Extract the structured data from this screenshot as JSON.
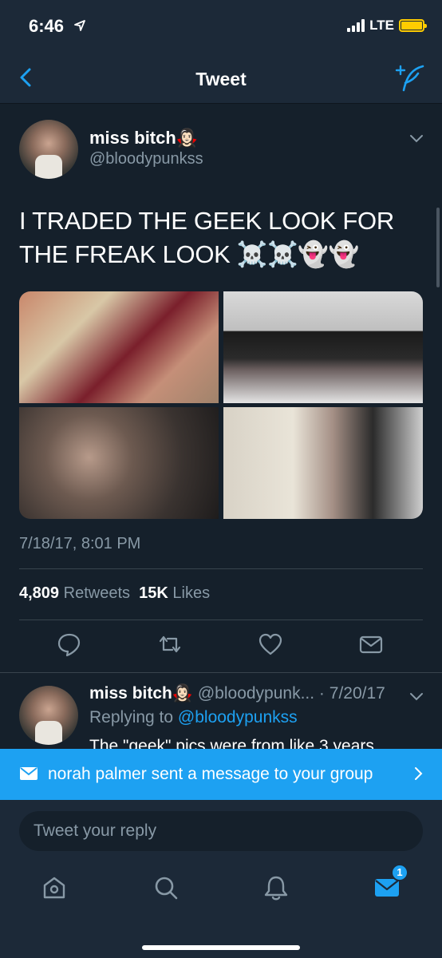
{
  "status_bar": {
    "time": "6:46",
    "network": "LTE",
    "signal_bars": 4,
    "battery_color": "#ffcc00"
  },
  "nav": {
    "title": "Tweet",
    "back_icon": "chevron-left-icon",
    "compose_icon": "compose-tweet-icon"
  },
  "tweet": {
    "display_name": "miss bitch🧛🏻‍♀️",
    "handle": "@bloodypunkss",
    "text": "I TRADED THE GEEK LOOK FOR THE FREAK LOOK ☠️☠️👻👻",
    "date": "7/18/17, 8:01 PM",
    "stats": {
      "retweets_count": "4,809",
      "retweets_label": "Retweets",
      "likes_count": "15K",
      "likes_label": "Likes"
    },
    "actions": [
      "reply-icon",
      "retweet-icon",
      "like-icon",
      "share-icon"
    ]
  },
  "reply": {
    "display_name": "miss bitch🧛🏻‍♀️",
    "meta": "@bloodypunk... · 7/20/17",
    "replying_prefix": "Replying to",
    "replying_to": "@bloodypunkss",
    "text": "The \"geek\" pics were from like 3 years"
  },
  "notification": {
    "text": "norah palmer sent a message to your group",
    "icon": "envelope-icon"
  },
  "composer": {
    "placeholder": "Tweet your reply"
  },
  "tabbar": {
    "tabs": [
      "home-icon",
      "search-icon",
      "notifications-icon",
      "messages-icon"
    ],
    "messages_badge": "1",
    "active_color": "#1da1f2"
  },
  "colors": {
    "background": "#15202b",
    "bar": "#1c2938",
    "accent": "#1da1f2",
    "muted": "#8899a6"
  }
}
